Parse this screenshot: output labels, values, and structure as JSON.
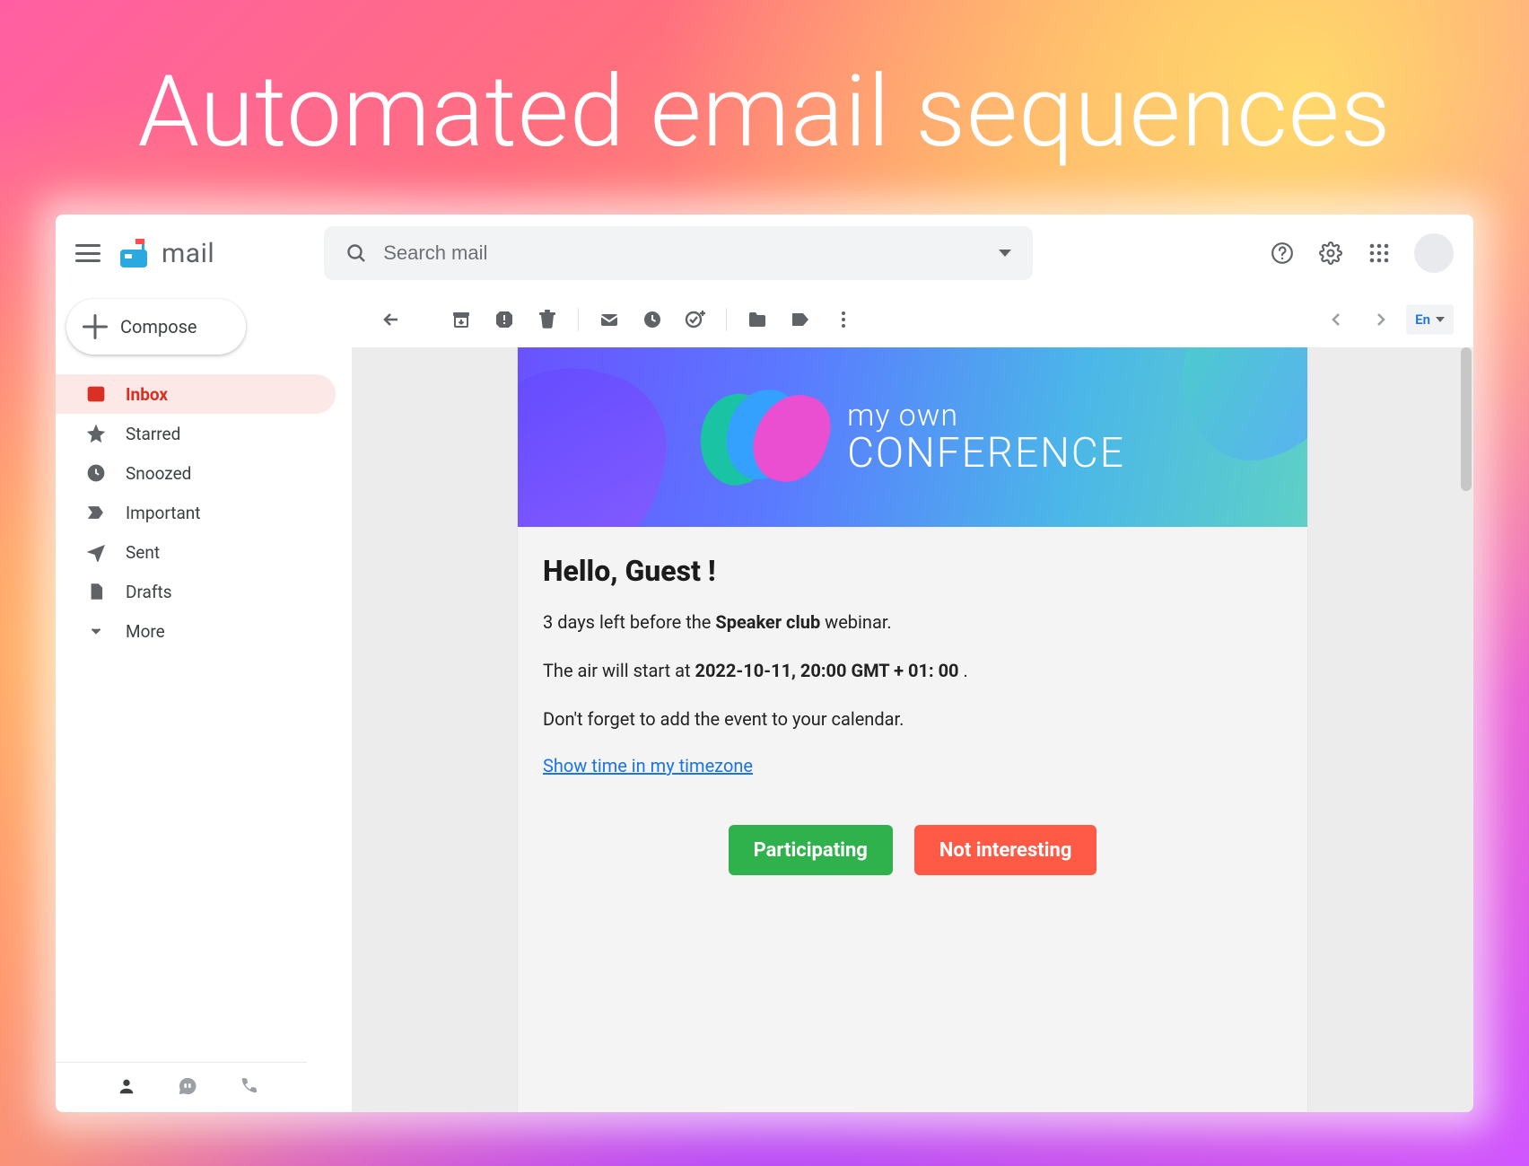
{
  "headline": "Automated email sequences",
  "app": {
    "brand": "mail",
    "search": {
      "placeholder": "Search mail"
    },
    "compose": "Compose",
    "lang": "En"
  },
  "sidebar": {
    "items": [
      {
        "label": "Inbox",
        "icon": "inbox",
        "active": true
      },
      {
        "label": "Starred",
        "icon": "star",
        "active": false
      },
      {
        "label": "Snoozed",
        "icon": "clock",
        "active": false
      },
      {
        "label": "Important",
        "icon": "important",
        "active": false
      },
      {
        "label": "Sent",
        "icon": "send",
        "active": false
      },
      {
        "label": "Drafts",
        "icon": "file",
        "active": false
      },
      {
        "label": "More",
        "icon": "chevron",
        "active": false
      }
    ]
  },
  "email": {
    "brand_line1": "my own",
    "brand_line2": "CONFERENCE",
    "greeting": "Hello, Guest !",
    "line1_pre": "3 days left before the ",
    "line1_bold": "Speaker club",
    "line1_post": " webinar.",
    "line2_pre": "The air will start at ",
    "line2_bold": "2022-10-11, 20:00 GMT + 01: 00",
    "line2_post": " .",
    "line3": "Don't forget to add the event to your calendar.",
    "tz_link": "Show time in my timezone",
    "cta_yes": "Participating",
    "cta_no": "Not interesting"
  }
}
